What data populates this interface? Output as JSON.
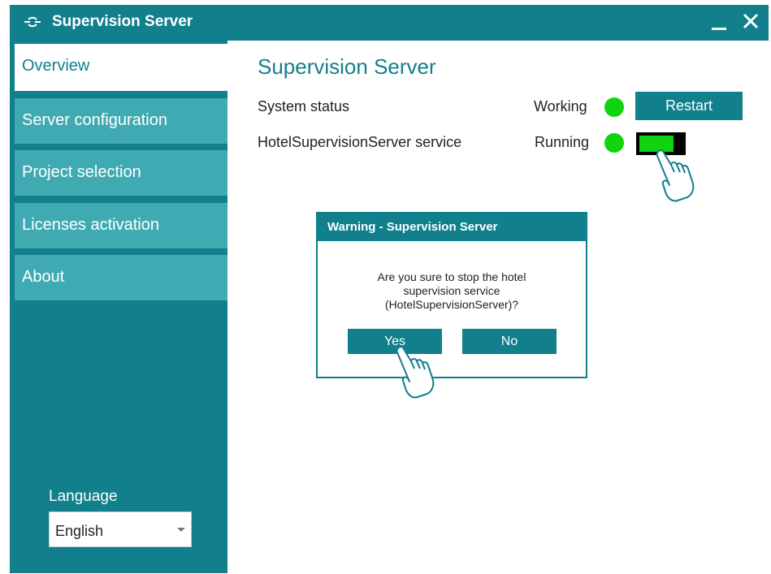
{
  "window": {
    "title": "Supervision Server",
    "minimize_icon": "minimize-icon",
    "close_icon": "close-icon",
    "app_icon": "supervision-logo-icon"
  },
  "sidebar": {
    "items": [
      {
        "label": "Overview",
        "active": true
      },
      {
        "label": "Server configuration",
        "active": false
      },
      {
        "label": "Project selection",
        "active": false
      },
      {
        "label": "Licenses activation",
        "active": false
      },
      {
        "label": "About",
        "active": false
      }
    ],
    "language": {
      "label": "Language",
      "selected": "English"
    }
  },
  "main": {
    "title": "Supervision Server",
    "rows": [
      {
        "label": "System status",
        "status": "Working",
        "action": "Restart"
      },
      {
        "label": "HotelSupervisionServer service",
        "status": "Running",
        "toggle": "on"
      }
    ]
  },
  "dialog": {
    "title": "Warning - Supervision Server",
    "message_lines": [
      "Are you sure to stop the hotel",
      "supervision service",
      "(HotelSupervisionServer)?"
    ],
    "yes_label": "Yes",
    "no_label": "No"
  },
  "colors": {
    "accent": "#127f8c",
    "nav_item": "#40aab2",
    "status_green": "#0fd40f"
  }
}
